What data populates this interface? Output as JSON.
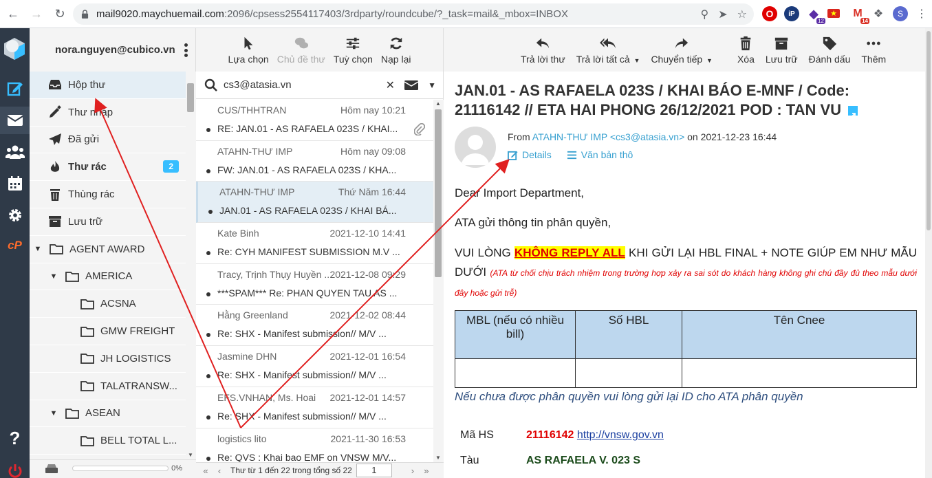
{
  "browser": {
    "url_host": "mail9020.maychuemail.com",
    "url_path": ":2096/cpsess2554117403/3rdparty/roundcube/?_task=mail&_mbox=INBOX",
    "ext_badge_1": "12",
    "ext_badge_2": "14",
    "profile_initial": "S"
  },
  "account": {
    "email": "nora.nguyen@cubico.vn"
  },
  "folders": [
    {
      "label": "Hộp thư",
      "icon": "inbox-icon",
      "selected": true
    },
    {
      "label": "Thư nháp",
      "icon": "pencil-icon"
    },
    {
      "label": "Đã gửi",
      "icon": "paper-plane-icon"
    },
    {
      "label": "Thư rác",
      "icon": "fire-icon",
      "count": "2",
      "bold": true
    },
    {
      "label": "Thùng rác",
      "icon": "trash-icon"
    },
    {
      "label": "Lưu trữ",
      "icon": "archive-icon"
    },
    {
      "label": "AGENT AWARD",
      "icon": "folder-icon",
      "caret": true,
      "level": 0
    },
    {
      "label": "AMERICA",
      "icon": "folder-icon",
      "caret": true,
      "level": 1
    },
    {
      "label": "ACSNA",
      "icon": "folder-icon",
      "level": 2
    },
    {
      "label": "GMW FREIGHT",
      "icon": "folder-icon",
      "level": 2
    },
    {
      "label": "JH LOGISTICS",
      "icon": "folder-icon",
      "level": 2
    },
    {
      "label": "TALATRANSW...",
      "icon": "folder-icon",
      "level": 2
    },
    {
      "label": "ASEAN",
      "icon": "folder-icon",
      "caret": true,
      "level": 1
    },
    {
      "label": "BELL TOTAL L...",
      "icon": "folder-icon",
      "level": 2
    }
  ],
  "quota": {
    "percent": "0%",
    "fill": 0
  },
  "list_toolbar": {
    "select": "Lựa chọn",
    "threads": "Chủ đề thư",
    "options": "Tuỳ chọn",
    "refresh": "Nạp lại"
  },
  "search": {
    "value": "cs3@atasia.vn"
  },
  "messages": [
    {
      "from": "CUS/THHTRAN",
      "date": "Hôm nay 10:21",
      "subject": "RE: JAN.01 - AS RAFAELA 023S / KHAI...",
      "attach": true
    },
    {
      "from": "ATAHN-THƯ IMP",
      "date": "Hôm nay 09:08",
      "subject": "FW: JAN.01 - AS RAFAELA 023S / KHA..."
    },
    {
      "from": "ATAHN-THƯ IMP",
      "date": "Thứ Năm 16:44",
      "subject": "JAN.01 - AS RAFAELA 023S / KHAI BÁ...",
      "selected": true
    },
    {
      "from": "Kate Binh",
      "date": "2021-12-10 14:41",
      "subject": "Re: CYH MANIFEST SUBMISSION M.V ..."
    },
    {
      "from": "Tracy, Trịnh Thụy Huyền ...",
      "date": "2021-12-08 09:29",
      "subject": "***SPAM*** Re: PHAN QUYEN TAU AS ..."
    },
    {
      "from": "Hằng Greenland",
      "date": "2021-12-02 08:44",
      "subject": "Re: SHX - Manifest submission// M/V ..."
    },
    {
      "from": "Jasmine DHN",
      "date": "2021-12-01 16:54",
      "subject": "Re: SHX - Manifest submission// M/V ..."
    },
    {
      "from": "EFS.VNHAN, Ms. Hoai",
      "date": "2021-12-01 14:57",
      "subject": "Re: SHX - Manifest submission// M/V ..."
    },
    {
      "from": "logistics lito",
      "date": "2021-11-30 16:53",
      "subject": "Re: QVS : Khai bao EMF on VNSW M/V..."
    }
  ],
  "pagination": {
    "text": "Thư từ 1 đến 22 trong tổng số 22",
    "page": "1"
  },
  "read_toolbar": {
    "reply": "Trả lời thư",
    "reply_all": "Trả lời tất cả",
    "forward": "Chuyển tiếp",
    "delete": "Xóa",
    "archive": "Lưu trữ",
    "mark": "Đánh dấu",
    "more": "Thêm"
  },
  "email": {
    "subject": "JAN.01 - AS RAFAELA 023S / KHAI BÁO E-MNF / Code: 21116142 // ETA HAI PHONG 26/12/2021 POD : TAN VU",
    "from_prefix": "From",
    "from_link": "ATAHN-THƯ IMP <cs3@atasia.vn>",
    "from_suffix": "on 2021-12-23 16:44",
    "details": "Details",
    "plain": "Văn bản thô",
    "greeting": "Dear Import Department,",
    "line1": "ATA gửi thông tin phân quyền,",
    "warn_pre": "VUI LÒNG",
    "warn_hl": "KHÔNG REPLY ALL",
    "warn_post": "KHI GỬI LẠI HBL FINAL + NOTE GIÚP EM NHƯ MẪU DƯỚI",
    "warn_note": "(ATA từ chối chịu trách nhiệm trong trường hợp xảy ra sai sót do khách hàng không ghi chú đầy đủ theo mẫu dưới đây hoặc gửi trễ)",
    "table_headers": [
      "MBL (nếu có nhiều bill)",
      "Số HBL",
      "Tên Cnee"
    ],
    "note_blue": "Nếu chưa được phân quyền vui lòng gửi lại ID cho ATA phân quyền",
    "hs_label": "Mã HS",
    "hs_code": "21116142",
    "hs_link": "http://vnsw.gov.vn",
    "ship_label": "Tàu",
    "ship_value": "AS RAFAELA  V. 023 S"
  },
  "colors": {
    "accent": "#37beff",
    "taskbar": "#2f3a48",
    "annotation": "#e02020",
    "highlight": "#ffff00"
  }
}
